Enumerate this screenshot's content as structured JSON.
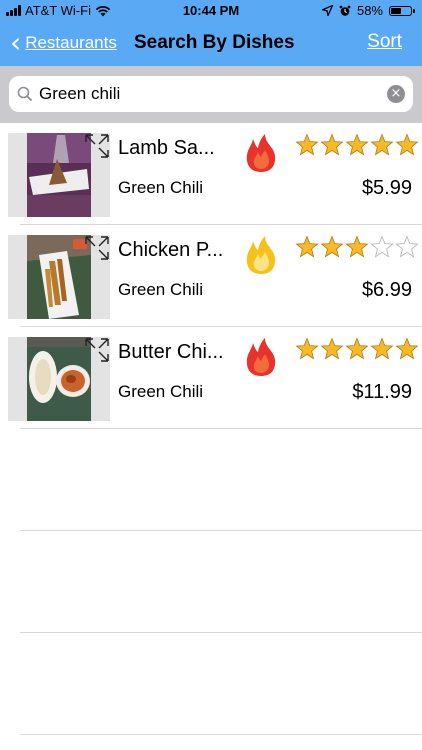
{
  "status_bar": {
    "carrier": "AT&T Wi-Fi",
    "time": "10:44 PM",
    "battery": "58%",
    "battery_level": 0.58
  },
  "nav": {
    "back_label": "Restaurants",
    "title": "Search By Dishes",
    "sort_label": "Sort"
  },
  "search": {
    "value": "Green chili",
    "icon": "search-icon"
  },
  "dishes": [
    {
      "name": "Lamb Sa...",
      "restaurant": "Green Chili",
      "price": "$5.99",
      "rating": 5,
      "spice": "hot",
      "spice_color": "#e8322b"
    },
    {
      "name": "Chicken P...",
      "restaurant": "Green Chili",
      "price": "$6.99",
      "rating": 3,
      "spice": "mild",
      "spice_color": "#f5c21b"
    },
    {
      "name": "Butter Chi...",
      "restaurant": "Green Chili",
      "price": "$11.99",
      "rating": 5,
      "spice": "hot",
      "spice_color": "#e8322b"
    }
  ],
  "colors": {
    "nav_bar": "#5aa9f5",
    "search_bar": "#c9c9ce",
    "star_fill": "#f7b928"
  }
}
